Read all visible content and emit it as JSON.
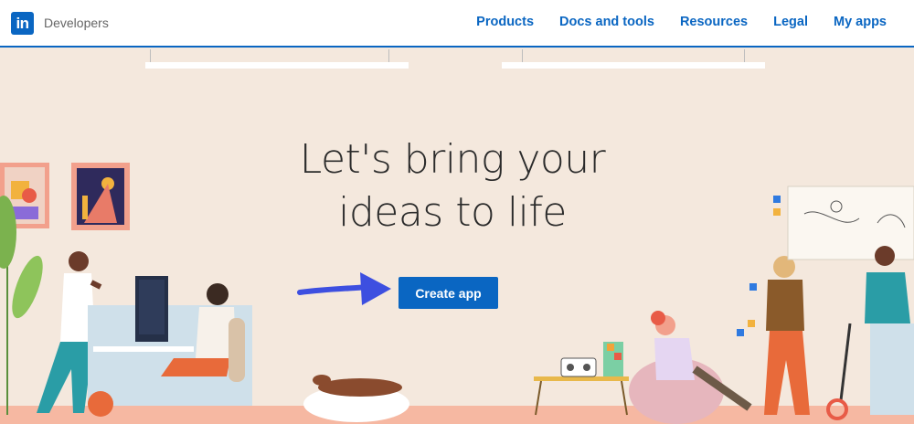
{
  "header": {
    "logo_text": "in",
    "brand": "Developers",
    "nav": [
      "Products",
      "Docs and tools",
      "Resources",
      "Legal",
      "My apps"
    ]
  },
  "hero": {
    "headline_line1": "Let's bring your",
    "headline_line2": "ideas to life",
    "cta_label": "Create app"
  },
  "colors": {
    "brand_blue": "#0a66c2",
    "hero_background": "#f4e8dd",
    "floor": "#f6b8a2",
    "arrow": "#3d4fe0"
  },
  "icons": [
    "linkedin-logo-icon",
    "arrow-right-icon"
  ]
}
